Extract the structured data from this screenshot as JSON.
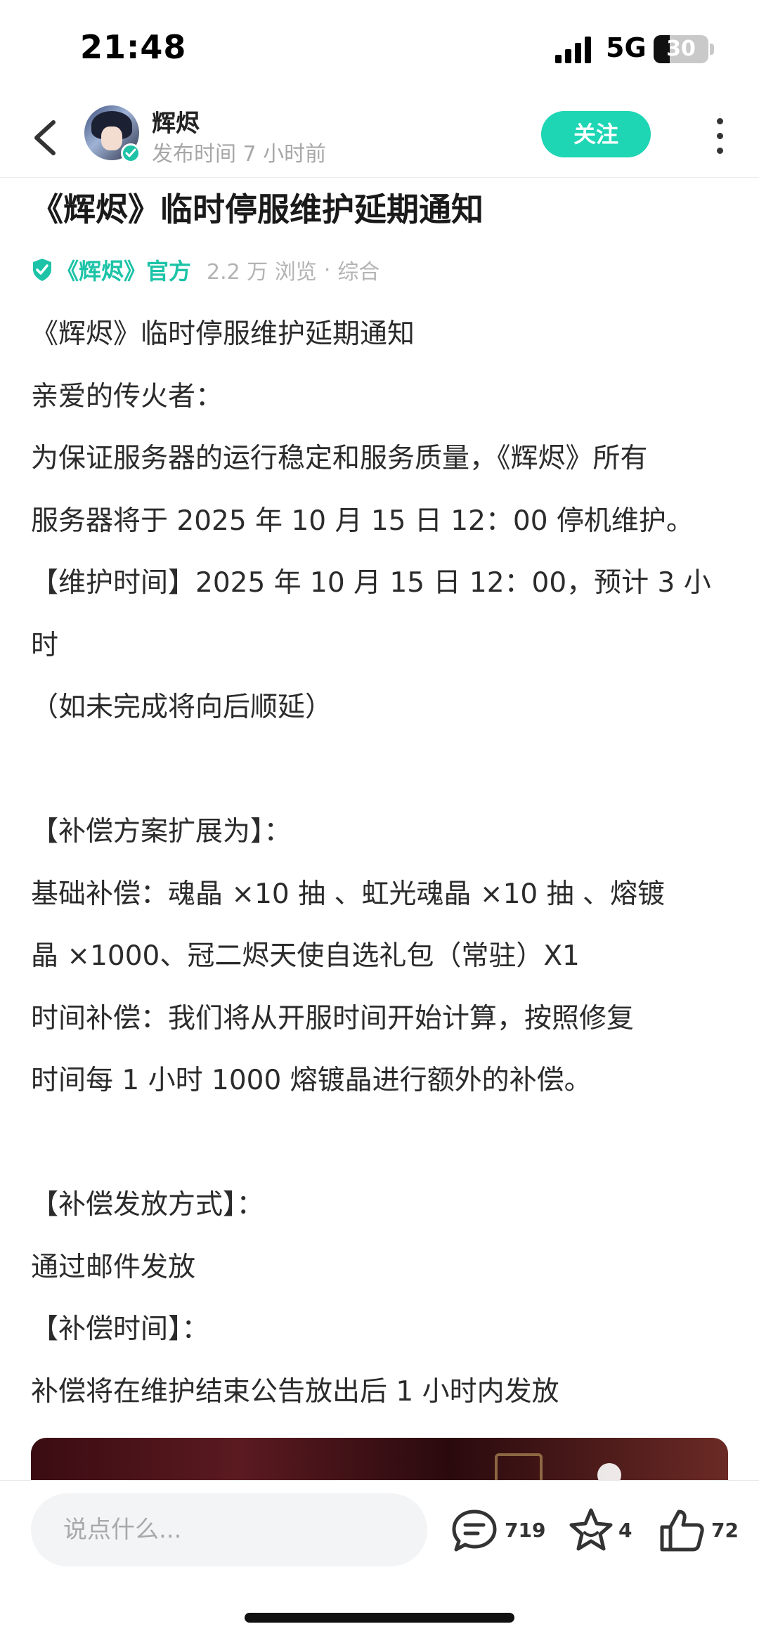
{
  "status_bar": {
    "time": "21:48",
    "network": "5G",
    "battery": "30",
    "battery_level": 0.3
  },
  "header": {
    "author_name": "辉烬",
    "post_time": "发布时间 7 小时前",
    "follow_label": "关注"
  },
  "article": {
    "title": "《辉烬》临时停服维护延期通知",
    "source": "《辉烬》官方",
    "views": "2.2 万 浏览",
    "separator": "·",
    "category": "综合",
    "paragraphs": [
      "《辉烬》临时停服维护延期通知",
      "亲爱的传火者：",
      "为保证服务器的运行稳定和服务质量，《辉烬》所有",
      "服务器将于 2025 年 10 月 15 日 12：00 停机维护。",
      "【维护时间】2025 年 10 月 15 日 12：00，预计 3 小时",
      "（如未完成将向后顺延）",
      "",
      "【补偿方案扩展为】：",
      "基础补偿：魂晶 ×10 抽 、虹光魂晶 ×10 抽 、熔镀",
      "晶 ×1000、冠二烬天使自选礼包（常驻）X1",
      "时间补偿：我们将从开服时间开始计算，按照修复",
      "时间每 1 小时 1000 熔镀晶进行额外的补偿。",
      "",
      "【补偿发放方式】：",
      "通过邮件发放",
      "【补偿时间】：",
      "补偿将在维护结束公告放出后 1 小时内发放"
    ]
  },
  "bottom_bar": {
    "comment_placeholder": "说点什么...",
    "comment_count": "719",
    "favorite_count": "4",
    "like_count": "72"
  },
  "colors": {
    "accent": "#1ed5b4",
    "official_green": "#1cc3a7"
  },
  "icons": [
    "back-arrow-icon",
    "verified-icon",
    "more-icon",
    "shield-check-icon",
    "comment-icon",
    "star-icon",
    "thumbs-up-icon"
  ]
}
